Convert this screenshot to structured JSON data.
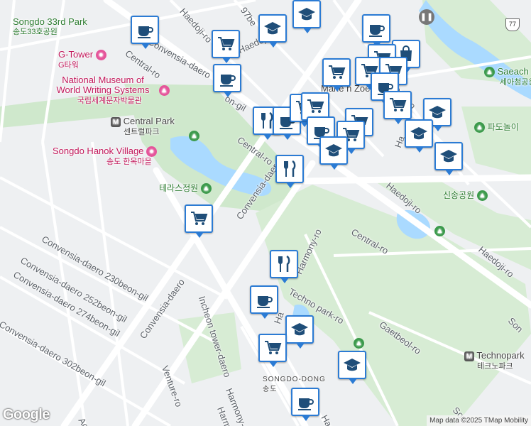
{
  "map": {
    "attribution": "Map data ©2025 TMap Mobility",
    "logo": "Google",
    "highway_shield": "77"
  },
  "roads": [
    {
      "id": "road-central-ro-1",
      "text": "Central-ro"
    },
    {
      "id": "road-central-ro-2",
      "text": "Central-ro"
    },
    {
      "id": "road-central-ro-3",
      "text": "Central-ro"
    },
    {
      "id": "road-convensia-daero-1",
      "text": "Convensia-daero"
    },
    {
      "id": "road-convensia-daero-2",
      "text": "Convensia-daero"
    },
    {
      "id": "road-convensia-daero-3",
      "text": "Convensia-daero"
    },
    {
      "id": "road-convensia-230",
      "text": "Convensia-daero 230beon-gil"
    },
    {
      "id": "road-convensia-252",
      "text": "Convensia-daero 252beon-gil"
    },
    {
      "id": "road-convensia-274",
      "text": "Convensia-daero 274beon-gil"
    },
    {
      "id": "road-convensia-302",
      "text": "Convensia-daero 302beon-gil"
    },
    {
      "id": "road-haedoji-1",
      "text": "Haedoji-ro"
    },
    {
      "id": "road-haedoji-2",
      "text": "Haedoji-ro"
    },
    {
      "id": "road-haedoji-3",
      "text": "Haedoji-ro"
    },
    {
      "id": "road-haedoji-4",
      "text": "Haedoji-ro"
    },
    {
      "id": "road-97beon",
      "text": "97be"
    },
    {
      "id": "road-on-gil",
      "text": "on-gil"
    },
    {
      "id": "road-incheon-tower",
      "text": "Incheon tower-daero"
    },
    {
      "id": "road-harmony-1",
      "text": "Harmony-ro"
    },
    {
      "id": "road-harmony-2",
      "text": "Harmony-ro"
    },
    {
      "id": "road-harmony-3",
      "text": "Harmo"
    },
    {
      "id": "road-techno-park",
      "text": "Techno park-ro"
    },
    {
      "id": "road-gaetbeol",
      "text": "Gaetbeol-ro"
    },
    {
      "id": "road-venture",
      "text": "Venture-ro"
    },
    {
      "id": "road-ha-1",
      "text": "Ha"
    },
    {
      "id": "road-ha-2",
      "text": "Ha"
    },
    {
      "id": "road-haes",
      "text": "Haes"
    },
    {
      "id": "road-aca",
      "text": "Aca"
    },
    {
      "id": "road-son-1",
      "text": "Son"
    },
    {
      "id": "road-son-2",
      "text": "Son"
    },
    {
      "id": "road-ong-ro",
      "text": "ong-ro"
    }
  ],
  "places": [
    {
      "id": "place-songdo-33rd-park",
      "en": "Songdo 33rd Park",
      "ko": "송도33호공원",
      "kind": "park"
    },
    {
      "id": "place-g-tower",
      "en": "G-Tower",
      "ko": "G타워",
      "kind": "attraction"
    },
    {
      "id": "place-writing-museum",
      "en": "National Museum of World Writing Systems",
      "ko": "국립세계문자박물관",
      "kind": "attraction"
    },
    {
      "id": "place-central-park-station",
      "en": "Central Park",
      "ko": "센트럴파크",
      "kind": "station"
    },
    {
      "id": "place-hanok-village",
      "en": "Songdo Hanok Village",
      "ko": "송도 한옥마을",
      "kind": "attraction"
    },
    {
      "id": "place-terrace-garden",
      "en": "",
      "ko": "테라스정원",
      "kind": "park"
    },
    {
      "id": "place-marie-n-zoe",
      "en": "Marie n Zoe",
      "ko": "",
      "kind": "shop"
    },
    {
      "id": "place-saeach",
      "en": "Saeach",
      "ko": "세아첨공원",
      "kind": "park"
    },
    {
      "id": "place-padonori",
      "en": "",
      "ko": "파도놀이",
      "kind": "park"
    },
    {
      "id": "place-sinsong-park",
      "en": "",
      "ko": "신송공원",
      "kind": "park"
    },
    {
      "id": "place-technopark",
      "en": "Technopark",
      "ko": "테크노파크",
      "kind": "station"
    },
    {
      "id": "place-songdo-dong",
      "en": "SONGDO-DONG",
      "ko": "송도",
      "kind": "district"
    }
  ],
  "markers": [
    {
      "type": "cafe"
    },
    {
      "type": "grocery"
    },
    {
      "type": "school"
    },
    {
      "type": "cafe"
    },
    {
      "type": "cafe"
    },
    {
      "type": "shopping"
    },
    {
      "type": "grocery"
    },
    {
      "type": "grocery"
    },
    {
      "type": "grocery"
    },
    {
      "type": "grocery"
    },
    {
      "type": "cafe"
    },
    {
      "type": "grocery"
    },
    {
      "type": "restaurant"
    },
    {
      "type": "cafe"
    },
    {
      "type": "grocery"
    },
    {
      "type": "grocery"
    },
    {
      "type": "grocery"
    },
    {
      "type": "school"
    },
    {
      "type": "cafe"
    },
    {
      "type": "grocery"
    },
    {
      "type": "school"
    },
    {
      "type": "school"
    },
    {
      "type": "school"
    },
    {
      "type": "restaurant"
    },
    {
      "type": "grocery"
    },
    {
      "type": "restaurant"
    },
    {
      "type": "cafe"
    },
    {
      "type": "school"
    },
    {
      "type": "grocery"
    },
    {
      "type": "school"
    },
    {
      "type": "cafe"
    },
    {
      "type": "school"
    }
  ]
}
